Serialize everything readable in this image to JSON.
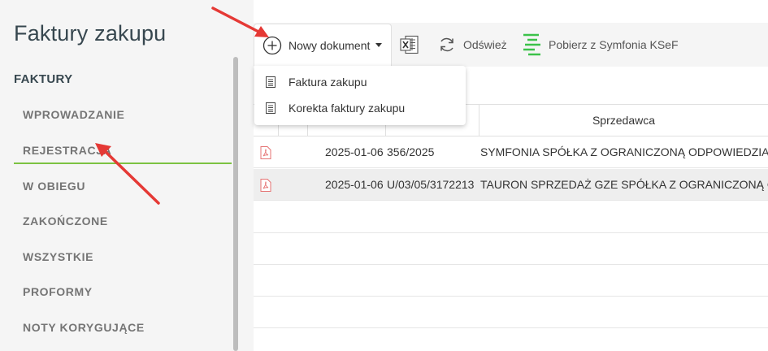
{
  "page_title": "Faktury zakupu",
  "sidebar": {
    "section_title": "FAKTURY",
    "items": [
      {
        "label": "WPROWADZANIE"
      },
      {
        "label": "REJESTRACJA",
        "active": true
      },
      {
        "label": "W OBIEGU"
      },
      {
        "label": "ZAKOŃCZONE"
      },
      {
        "label": "WSZYSTKIE"
      },
      {
        "label": "PROFORMY"
      },
      {
        "label": "NOTY KORYGUJĄCE"
      }
    ]
  },
  "toolbar": {
    "new_document_label": "Nowy dokument",
    "excel_icon": "excel-icon",
    "refresh_label": "Odśwież",
    "ksef_label": "Pobierz z Symfonia KSeF"
  },
  "dropdown": {
    "items": [
      {
        "label": "Faktura zakupu",
        "icon": "document-icon"
      },
      {
        "label": "Korekta faktury zakupu",
        "icon": "document-icon"
      }
    ]
  },
  "table": {
    "columns": [
      "",
      "",
      "Sprzedawca"
    ],
    "rows": [
      {
        "date": "2025-01-06",
        "number": "356/2025",
        "seller": "SYMFONIA SPÓŁKA Z OGRANICZONĄ ODPOWIEDZIALNOŚCIĄ"
      },
      {
        "date": "2025-01-06",
        "number": "U/03/05/3172213",
        "seller": "TAURON SPRZEDAŻ GZE SPÓŁKA Z OGRANICZONĄ ODPOWIEDZIALNOŚCIĄ"
      }
    ]
  },
  "colors": {
    "active_underline": "#7cc242",
    "annotation_arrow": "#e53935",
    "pdf_icon": "#e57373",
    "ksef_icon": "#3cc24a"
  }
}
